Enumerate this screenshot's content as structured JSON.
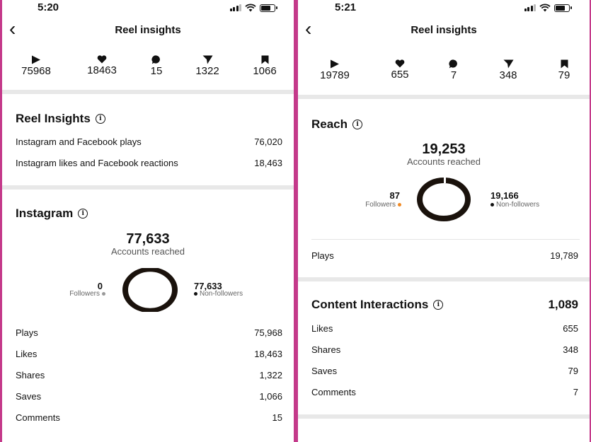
{
  "left": {
    "status": {
      "time": "5:20"
    },
    "header": {
      "title": "Reel insights"
    },
    "metrics": [
      {
        "icon": "play-icon",
        "value": "75968"
      },
      {
        "icon": "heart-icon",
        "value": "18463"
      },
      {
        "icon": "comment-icon",
        "value": "15"
      },
      {
        "icon": "share-icon",
        "value": "1322"
      },
      {
        "icon": "bookmark-icon",
        "value": "1066"
      }
    ],
    "reel_insights": {
      "title": "Reel Insights",
      "rows": [
        {
          "label": "Instagram and Facebook plays",
          "value": "76,020"
        },
        {
          "label": "Instagram likes and Facebook reactions",
          "value": "18,463"
        }
      ]
    },
    "instagram": {
      "title": "Instagram",
      "accounts_reached": "77,633",
      "accounts_reached_label": "Accounts reached",
      "followers_value": "0",
      "followers_label": "Followers",
      "nonfollowers_value": "77,633",
      "nonfollowers_label": "Non-followers",
      "followers_fraction": 0.0,
      "rows": [
        {
          "label": "Plays",
          "value": "75,968"
        },
        {
          "label": "Likes",
          "value": "18,463"
        },
        {
          "label": "Shares",
          "value": "1,322"
        },
        {
          "label": "Saves",
          "value": "1,066"
        },
        {
          "label": "Comments",
          "value": "15"
        }
      ]
    }
  },
  "right": {
    "status": {
      "time": "5:21"
    },
    "header": {
      "title": "Reel insights"
    },
    "metrics": [
      {
        "icon": "play-icon",
        "value": "19789"
      },
      {
        "icon": "heart-icon",
        "value": "655"
      },
      {
        "icon": "comment-icon",
        "value": "7"
      },
      {
        "icon": "share-icon",
        "value": "348"
      },
      {
        "icon": "bookmark-icon",
        "value": "79"
      }
    ],
    "reach": {
      "title": "Reach",
      "accounts_reached": "19,253",
      "accounts_reached_label": "Accounts reached",
      "followers_value": "87",
      "followers_label": "Followers",
      "nonfollowers_value": "19,166",
      "nonfollowers_label": "Non-followers",
      "followers_fraction": 0.0045,
      "plays_label": "Plays",
      "plays_value": "19,789"
    },
    "content_interactions": {
      "title": "Content Interactions",
      "total": "1,089",
      "rows": [
        {
          "label": "Likes",
          "value": "655"
        },
        {
          "label": "Shares",
          "value": "348"
        },
        {
          "label": "Saves",
          "value": "79"
        },
        {
          "label": "Comments",
          "value": "7"
        }
      ]
    }
  },
  "colors": {
    "follower_dot": "#f08a24",
    "nonfollower_dot": "#111111",
    "donut": "#1a120c",
    "separator": "#e8e8e8"
  }
}
